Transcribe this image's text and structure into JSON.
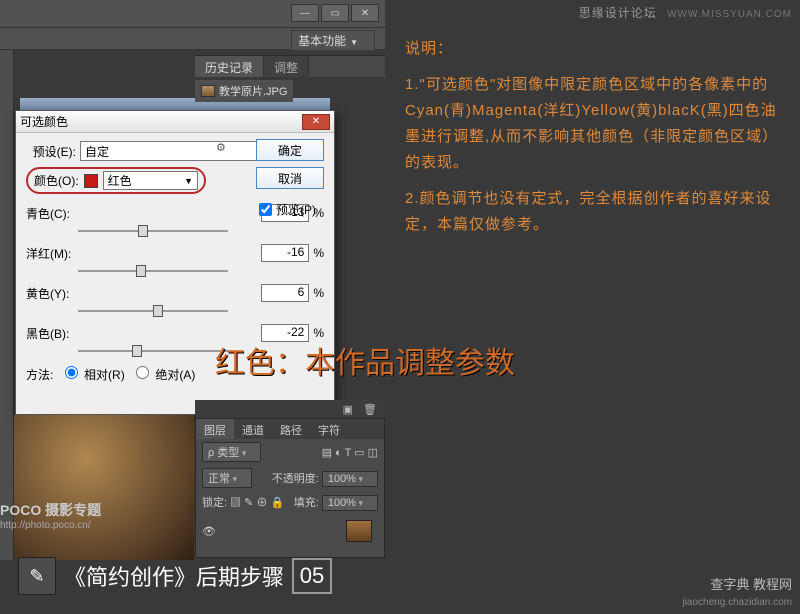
{
  "watermark": {
    "top_right_text": "思缘设计论坛",
    "top_right_site": "WWW.MISSYUAN.COM",
    "bottom_right_brand": "查字典",
    "bottom_right_sub": "教程网",
    "bottom_right_url": "jiaocheng.chazidian.com",
    "left_brand": "POCO 摄影专题",
    "left_url": "http://photo.poco.cn/"
  },
  "app": {
    "mode_label": "基本功能",
    "history_tab": "历史记录",
    "adjust_tab": "调整",
    "doc_name": "教学原片.JPG"
  },
  "dialog": {
    "title": "可选颜色",
    "preset_label": "预设(E):",
    "preset_value": "自定",
    "color_label": "颜色(O):",
    "color_value": "红色",
    "sliders": {
      "cyan": {
        "label": "青色(C):",
        "value": "-13"
      },
      "magenta": {
        "label": "洋红(M):",
        "value": "-16"
      },
      "yellow": {
        "label": "黄色(Y):",
        "value": "6"
      },
      "black": {
        "label": "黑色(B):",
        "value": "-22"
      }
    },
    "percent": "%",
    "method_label": "方法:",
    "method_relative": "相对(R)",
    "method_absolute": "绝对(A)",
    "ok": "确定",
    "cancel": "取消",
    "preview": "预览(P)"
  },
  "layers": {
    "tabs": {
      "layer": "图层",
      "channel": "通道",
      "path": "路径",
      "char": "字符"
    },
    "kind_label": "ρ 类型",
    "blend": "正常",
    "opacity_label": "不透明度:",
    "opacity_value": "100%",
    "lock_label": "锁定:",
    "fill_label": "填充:",
    "fill_value": "100%"
  },
  "explain": {
    "heading": "说明：",
    "p1": "1.\"可选颜色\"对图像中限定颜色区域中的各像素中的Cyan(青)Magenta(洋红)Yellow(黄)blacK(黑)四色油墨进行调整,从而不影响其他颜色（非限定颜色区域）的表现。",
    "p2": "2.颜色调节也没有定式，完全根据创作者的喜好来设定，本篇仅做参考。"
  },
  "headline": "红色：本作品调整参数",
  "step": {
    "text": "《简约创作》后期步骤",
    "num": "05"
  }
}
